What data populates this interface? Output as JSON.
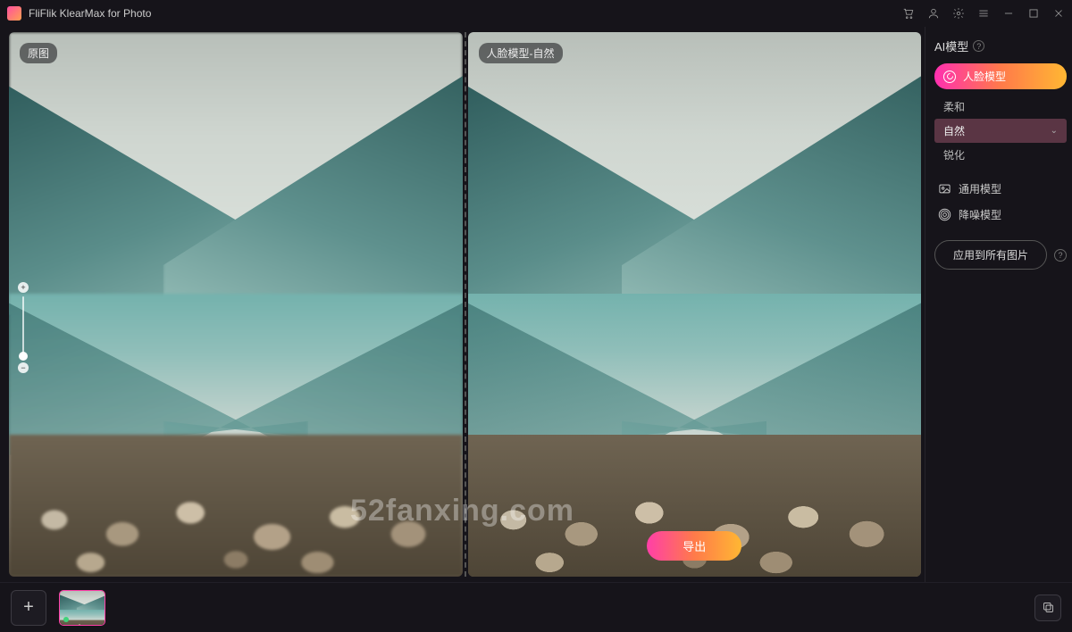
{
  "app": {
    "title": "FliFlik KlearMax for Photo"
  },
  "panes": {
    "original_label": "原图",
    "result_label": "人脸模型-自然"
  },
  "watermark": "52fanxing.com",
  "export_label": "导出",
  "sidebar": {
    "header": "AI模型",
    "face_model": "人脸模型",
    "sub_soft": "柔和",
    "sub_natural": "自然",
    "sub_sharp": "锐化",
    "general_model": "通用模型",
    "denoise_model": "降噪模型",
    "apply_all": "应用到所有图片"
  }
}
